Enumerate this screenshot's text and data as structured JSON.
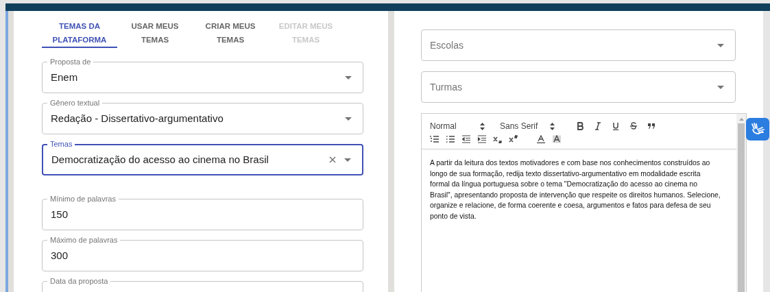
{
  "tabs": [
    {
      "label": "TEMAS DA PLATAFORMA",
      "selected": true,
      "disabled": false
    },
    {
      "label": "USAR MEUS TEMAS",
      "selected": false,
      "disabled": false
    },
    {
      "label": "CRIAR MEUS TEMAS",
      "selected": false,
      "disabled": false
    },
    {
      "label": "EDITAR MEUS TEMAS",
      "selected": false,
      "disabled": true
    }
  ],
  "left_fields": [
    {
      "kind": "select",
      "label": "Proposta de",
      "value": "Enem",
      "focused": false,
      "clearable": false
    },
    {
      "kind": "select",
      "label": "Gênero textual",
      "value": "Redação - Dissertativo-argumentativo",
      "focused": false,
      "clearable": false
    },
    {
      "kind": "select",
      "label": "Temas",
      "value": "Democratização do acesso ao cinema no Brasil",
      "focused": true,
      "clearable": true
    },
    {
      "kind": "number",
      "label": "Mínimo de palavras",
      "value": "150",
      "focused": false,
      "clearable": false
    },
    {
      "kind": "number",
      "label": "Máximo de palavras",
      "value": "300",
      "focused": false,
      "clearable": false
    },
    {
      "kind": "date",
      "label": "Data da proposta",
      "focused": false,
      "clearable": false
    }
  ],
  "right_fields": [
    {
      "placeholder": "Escolas"
    },
    {
      "placeholder": "Turmas"
    }
  ],
  "editor": {
    "header_select": "Normal",
    "font_select": "Sans Serif",
    "content": "A partir da leitura dos textos motivadores e com base nos conhecimentos construídos ao longo de sua formação, redija texto dissertativo-argumentativo em modalidade escrita formal da língua portuguesa sobre o tema \"Democratização do acesso ao cinema no Brasil\", apresentando proposta de intervenção que respeite os direitos humanos. Selecione, organize e relacione, de forma coerente e coesa, argumentos e fatos para defesa de seu ponto de vista."
  }
}
